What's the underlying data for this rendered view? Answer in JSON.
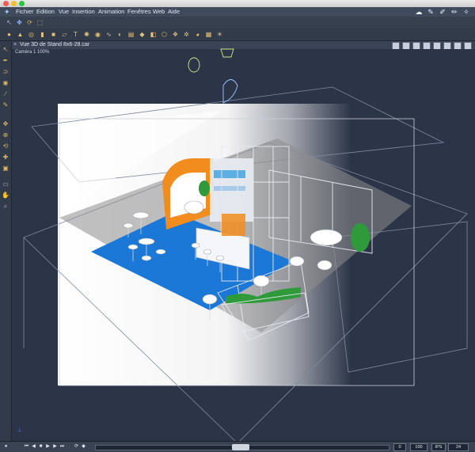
{
  "menu": {
    "items": [
      "Fichier",
      "Edition",
      "Vue",
      "Insertion",
      "Animation",
      "Fenêtres",
      "Web",
      "Aide"
    ]
  },
  "view": {
    "title": "Vue 3D de Stand 8x6-28.car",
    "camera": "Caméra 1 100%"
  },
  "bottom": {
    "field_left": "0",
    "field_mid": "100",
    "field_fps": "IPS",
    "field_right": "24"
  },
  "icons": {
    "app": "app-logo-icon",
    "toolbar_top": [
      "select-icon",
      "move-icon",
      "rotate-icon",
      "scale-icon",
      "copy-icon",
      "group-icon"
    ],
    "toolbar_objects": [
      "sphere-icon",
      "cone-icon",
      "torus-icon",
      "cylinder-icon",
      "box-icon",
      "plane-icon",
      "text-icon",
      "light-icon",
      "camera-icon",
      "spline-icon",
      "lathe-icon",
      "extrude-icon",
      "loft-icon",
      "boolean-icon",
      "bevel-icon",
      "deform-icon",
      "particle-icon",
      "material-icon",
      "texture-icon",
      "sky-icon",
      "render-icon"
    ],
    "left_tools": [
      "arrow-icon",
      "pen-icon",
      "magnet-icon",
      "eye-icon",
      "knife-icon",
      "brush-icon",
      "move-view-icon",
      "zoom-view-icon",
      "orbit-icon",
      "pan-icon",
      "camera-view-icon",
      "hand-icon",
      "magnifier-icon"
    ]
  },
  "colors": {
    "carpet": "#1b78d6",
    "accent_orange": "#f28c1e",
    "wireframe": "#d9dde6",
    "plant": "#2f9a3a",
    "viewport_bg": "#2c3548"
  }
}
